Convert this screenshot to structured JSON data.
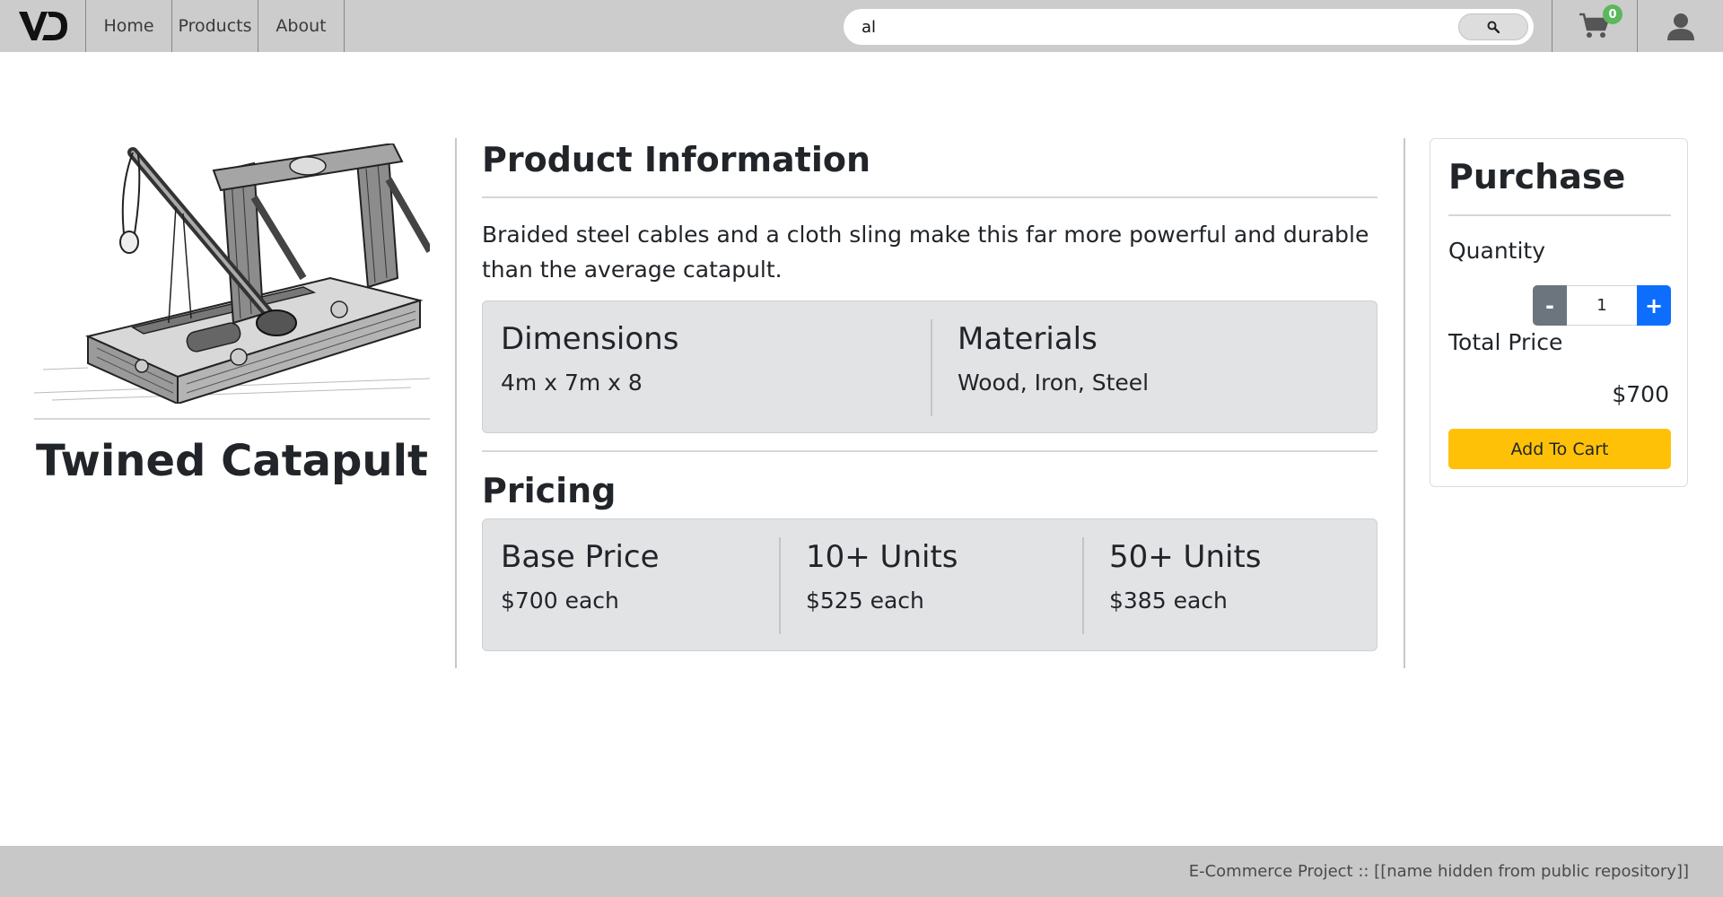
{
  "header": {
    "logo_text": "VD",
    "nav": [
      {
        "label": "Home"
      },
      {
        "label": "Products"
      },
      {
        "label": "About"
      }
    ],
    "search": {
      "value": "al",
      "placeholder": ""
    },
    "cart_count": "0",
    "icons": {
      "search": "search-icon",
      "cart": "cart-icon",
      "user": "user-icon"
    }
  },
  "product": {
    "name": "Twined Catapult",
    "image": "catapult-illustration"
  },
  "info": {
    "title": "Product Information",
    "description": "Braided steel cables and a cloth sling make this far more powerful and durable than the average catapult.",
    "specs": [
      {
        "label": "Dimensions",
        "value": "4m x 7m x 8"
      },
      {
        "label": "Materials",
        "value": "Wood, Iron, Steel"
      }
    ]
  },
  "pricing": {
    "title": "Pricing",
    "tiers": [
      {
        "label": "Base Price",
        "value": "$700 each"
      },
      {
        "label": "10+ Units",
        "value": "$525 each"
      },
      {
        "label": "50+ Units",
        "value": "$385 each"
      }
    ]
  },
  "purchase": {
    "title": "Purchase",
    "quantity_label": "Quantity",
    "minus_label": "-",
    "plus_label": "+",
    "quantity": "1",
    "total_label": "Total Price",
    "total": "$700",
    "add_label": "Add To Cart"
  },
  "footer": {
    "text": "E-Commerce Project :: [[name hidden from public repository]]"
  },
  "colors": {
    "header_bg": "#cccccc",
    "panel_bg": "#e2e3e5",
    "add_button": "#ffc107",
    "plus_button": "#0d6efd",
    "minus_button": "#6c757d",
    "badge": "#5cb85c"
  }
}
